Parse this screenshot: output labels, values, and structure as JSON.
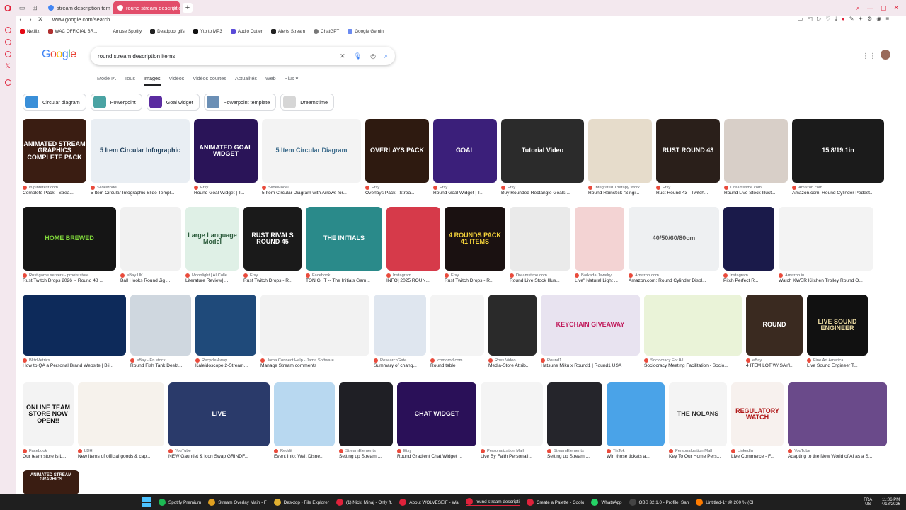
{
  "browser": {
    "tabs": [
      {
        "label": "stream description templa",
        "active": false
      },
      {
        "label": "round stream description",
        "active": true
      }
    ],
    "url": "www.google.com/search"
  },
  "bookmarks": [
    "Netflix",
    "WAC OFFICIAL BR...",
    "Amuse Spotify",
    "Deadpool gifs",
    "Ytb to MP3",
    "Audio Cutter",
    "Alerts Stream",
    "ChatGPT",
    "Google Gemini"
  ],
  "search": {
    "logo": "Google",
    "query": "round stream description items"
  },
  "search_tabs": [
    "Mode IA",
    "Tous",
    "Images",
    "Vidéos",
    "Vidéos courtes",
    "Actualités",
    "Web",
    "Plus ▾"
  ],
  "chips": [
    {
      "label": "Circular diagram",
      "color": "#3a8fd8"
    },
    {
      "label": "Powerpoint",
      "color": "#4aa3a3"
    },
    {
      "label": "Goal widget",
      "color": "#5b2ca0"
    },
    {
      "label": "Powerpoint template",
      "color": "#6b8fb5"
    },
    {
      "label": "Dreamstime",
      "color": "#d6d6d6"
    }
  ],
  "rows": [
    [
      {
        "src": "in.pinterest.com",
        "title": "Complete Pack - Strea...",
        "text": "ANIMATED STREAM GRAPHICS COMPLETE PACK",
        "bg": "#3a1d12",
        "w": 90
      },
      {
        "src": "SlideModel",
        "title": "5 Item Circular Infographic Slide Templ...",
        "text": "5 Item Circular Infographic",
        "bg": "#e9eef3",
        "fg": "#1c3d5a",
        "w": 140
      },
      {
        "src": "Etsy",
        "title": "Round Goal Widget | T...",
        "text": "ANIMATED GOAL WIDGET",
        "bg": "#2a1458",
        "w": 90
      },
      {
        "src": "SlideModel",
        "title": "5 Item Circular Diagram with Arrows for...",
        "text": "5 Item Circular Diagram",
        "bg": "#f3f3f3",
        "fg": "#3a6a8a",
        "w": 140
      },
      {
        "src": "Etsy",
        "title": "Overlays Pack - Strea...",
        "text": "OVERLAYS PACK",
        "bg": "#2e1a10",
        "w": 90
      },
      {
        "src": "Etsy",
        "title": "Round Goal Widget | T...",
        "text": "GOAL",
        "bg": "#3b1f7a",
        "w": 90
      },
      {
        "src": "Etsy",
        "title": "Buy Rounded Rectangle Goals ...",
        "text": "Tutorial Video",
        "bg": "#2b2b2b",
        "w": 117
      },
      {
        "src": "Integrated Therapy Work",
        "title": "Round Rainstick \"Singi...",
        "text": "",
        "bg": "#e6dccb",
        "w": 90
      },
      {
        "src": "Etsy",
        "title": "Rust Round 43 | Twitch...",
        "text": "RUST ROUND 43",
        "bg": "#2a1f1a",
        "w": 90
      },
      {
        "src": "Dreamstime.com",
        "title": "Round Live Stock Illust...",
        "text": "",
        "bg": "#d8cfc8",
        "w": 90
      },
      {
        "src": "Amazon.com",
        "title": "Amazon.com: Round Cylinder Pedest...",
        "text": "15.8/19.1in",
        "bg": "#1b1b1b",
        "w": 130
      }
    ],
    [
      {
        "src": "Rust game servers - proofs.store",
        "title": "Rust Twitch Drops 2026 -- Round 48 ...",
        "text": "HOME BREWED",
        "bg": "#151515",
        "fg": "#7fd63a",
        "w": 132
      },
      {
        "src": "eBay UK",
        "title": "Ball Hooks Round Jig ...",
        "text": "",
        "bg": "#f1f1f1",
        "w": 86
      },
      {
        "src": "Moonlight | AI Colle",
        "title": "Literature Review] ...",
        "text": "Large Language Model",
        "bg": "#dff0e6",
        "fg": "#2a5a3a",
        "w": 76
      },
      {
        "src": "Etsy",
        "title": "Rust Twitch Drops - R...",
        "text": "RUST RIVALS ROUND 45",
        "bg": "#1a1a1a",
        "w": 82
      },
      {
        "src": "Facebook",
        "title": "TONIGHT -- The Initials Gam...",
        "text": "THE INITIALS",
        "bg": "#2a8a8a",
        "w": 108
      },
      {
        "src": "Instagram",
        "title": "INFO] 2025 ROUN...",
        "text": "",
        "bg": "#d63a4a",
        "w": 76
      },
      {
        "src": "Etsy",
        "title": "Rust Twitch Drops - R...",
        "text": "4 ROUNDS PACK 41 ITEMS",
        "bg": "#1a1111",
        "fg": "#f5d33a",
        "w": 86
      },
      {
        "src": "Dreamstime.com",
        "title": "Round Live Stock Illus...",
        "text": "",
        "bg": "#eaeaea",
        "w": 86
      },
      {
        "src": "Barkada Jewelry",
        "title": "Live\" Natural Light ...",
        "text": "",
        "bg": "#f3d3d3",
        "w": 70
      },
      {
        "src": "Amazon.com",
        "title": "Amazon.com: Round Cylinder Displ...",
        "text": "40/50/60/80cm",
        "bg": "#eef0f2",
        "fg": "#555",
        "w": 128
      },
      {
        "src": "Instagram",
        "title": "Pitch Perfect R...",
        "text": "",
        "bg": "#1a1a4a",
        "w": 72
      },
      {
        "src": "Amazon.in",
        "title": "Watch KWER Kitchen Trolley Round O...",
        "text": "",
        "bg": "#f3f3f3",
        "fg": "#333",
        "w": 134
      }
    ],
    [
      {
        "src": "BlitzMetrics",
        "title": "How to QA a Personal Brand Website | Bli...",
        "text": "",
        "bg": "#0d2a5a",
        "w": 146
      },
      {
        "src": "eBay - En stock",
        "title": "Round Fish Tank Deskt...",
        "text": "",
        "bg": "#cfd7df",
        "w": 86
      },
      {
        "src": "Recycle Away",
        "title": "Kaleidoscope 2-Stream...",
        "text": "",
        "bg": "#1f4a7a",
        "w": 86
      },
      {
        "src": "Jama Connect Help - Jama Software",
        "title": "Manage Stream comments",
        "text": "",
        "bg": "#f2f2f2",
        "w": 154
      },
      {
        "src": "ResearchGate",
        "title": "Summary of chang...",
        "text": "",
        "bg": "#dfe6ef",
        "w": 74
      },
      {
        "src": "icomorod.com",
        "title": "Round table",
        "text": "",
        "bg": "#f4f4f4",
        "w": 76
      },
      {
        "src": "Ross Video",
        "title": "Media-Store Attrib...",
        "text": "",
        "bg": "#2a2a2a",
        "w": 68
      },
      {
        "src": "Round1",
        "title": "Hatsune Miku x Round1 | Round1 USA",
        "text": "KEYCHAIN GIVEAWAY",
        "bg": "#e8e3f0",
        "fg": "#c0185a",
        "w": 140
      },
      {
        "src": "Sociocracy For All",
        "title": "Sociocracy Meeting Facilitation - Socio...",
        "text": "",
        "bg": "#eaf3d8",
        "fg": "#c0185a",
        "w": 138
      },
      {
        "src": "eBay",
        "title": "4 ITEM LOT W/ SAYI...",
        "text": "ROUND",
        "bg": "#3a2a20",
        "w": 80
      },
      {
        "src": "Fine Art America",
        "title": "Live Sound Engineer T...",
        "text": "LIVE SOUND ENGINEER",
        "bg": "#111",
        "fg": "#e8d8a0",
        "w": 86
      }
    ],
    [
      {
        "src": "Facebook",
        "title": "Our team store is L...",
        "text": "ONLINE TEAM STORE NOW OPEN!!",
        "bg": "#f3f3f3",
        "fg": "#111",
        "w": 72
      },
      {
        "src": "LDH",
        "title": "New items of official goods & cap...",
        "text": "",
        "bg": "#f6f2ec",
        "w": 122
      },
      {
        "src": "YouTube",
        "title": "NEW Gauntlet & Icon Swap GRINDF...",
        "text": "LIVE",
        "bg": "#2a3a6a",
        "w": 143
      },
      {
        "src": "Reddit",
        "title": "Event Info: Walt Disne...",
        "text": "",
        "bg": "#b8d8f0",
        "w": 86
      },
      {
        "src": "StreamElements",
        "title": "Setting up Stream ...",
        "text": "",
        "bg": "#1f1f25",
        "w": 76
      },
      {
        "src": "Etsy",
        "title": "Round Gradient Chat Widget ...",
        "text": "CHAT WIDGET",
        "bg": "#2a1058",
        "w": 112
      },
      {
        "src": "Personalization Mall",
        "title": "Live By Faith Personali...",
        "text": "",
        "bg": "#f4f4f4",
        "fg": "#333",
        "w": 88
      },
      {
        "src": "StreamElements",
        "title": "Setting up Stream ...",
        "text": "",
        "bg": "#25252b",
        "w": 78
      },
      {
        "src": "TikTok",
        "title": "Win those tickets a...",
        "text": "",
        "bg": "#4aa3e8",
        "w": 82
      },
      {
        "src": "Personalization Mall",
        "title": "Key To Our Home Pers...",
        "text": "THE NOLANS",
        "bg": "#f4f4f4",
        "fg": "#333",
        "w": 82
      },
      {
        "src": "LinkedIn",
        "title": "Live Commerce - F...",
        "text": "REGULATORY WATCH",
        "bg": "#f7f1ee",
        "fg": "#b01818",
        "w": 74
      },
      {
        "src": "YouTube",
        "title": "Adapting to the New World of AI as a S...",
        "text": "",
        "bg": "#6a4a8a",
        "w": 140
      }
    ]
  ],
  "partial_row": {
    "text": "ANIMATED STREAM GRAPHICS",
    "bg": "#3a1d12"
  },
  "taskbar": {
    "items": [
      {
        "label": "Spotify Premium",
        "color": "#1db954"
      },
      {
        "label": "Stream Overlay Main - F",
        "color": "#e0a020"
      },
      {
        "label": "Desktop - File Explorer",
        "color": "#e0b030"
      },
      {
        "label": "(1) Nicki Minaj - Only ft.",
        "color": "#e0223b"
      },
      {
        "label": "About WOLVESEIF - Wa",
        "color": "#e0223b"
      },
      {
        "label": "round stream descripti",
        "color": "#e0223b",
        "active": true
      },
      {
        "label": "Create a Palette - Coolo",
        "color": "#e0223b"
      },
      {
        "label": "WhatsApp",
        "color": "#25d366"
      },
      {
        "label": "OBS 32.1.0 - Profile: San",
        "color": "#444"
      },
      {
        "label": "Untitled-1* @ 200 % (CI",
        "color": "#ff7c00"
      }
    ],
    "lang": "FRA US",
    "time": "11:06 PM",
    "date": "4/18/2026"
  }
}
